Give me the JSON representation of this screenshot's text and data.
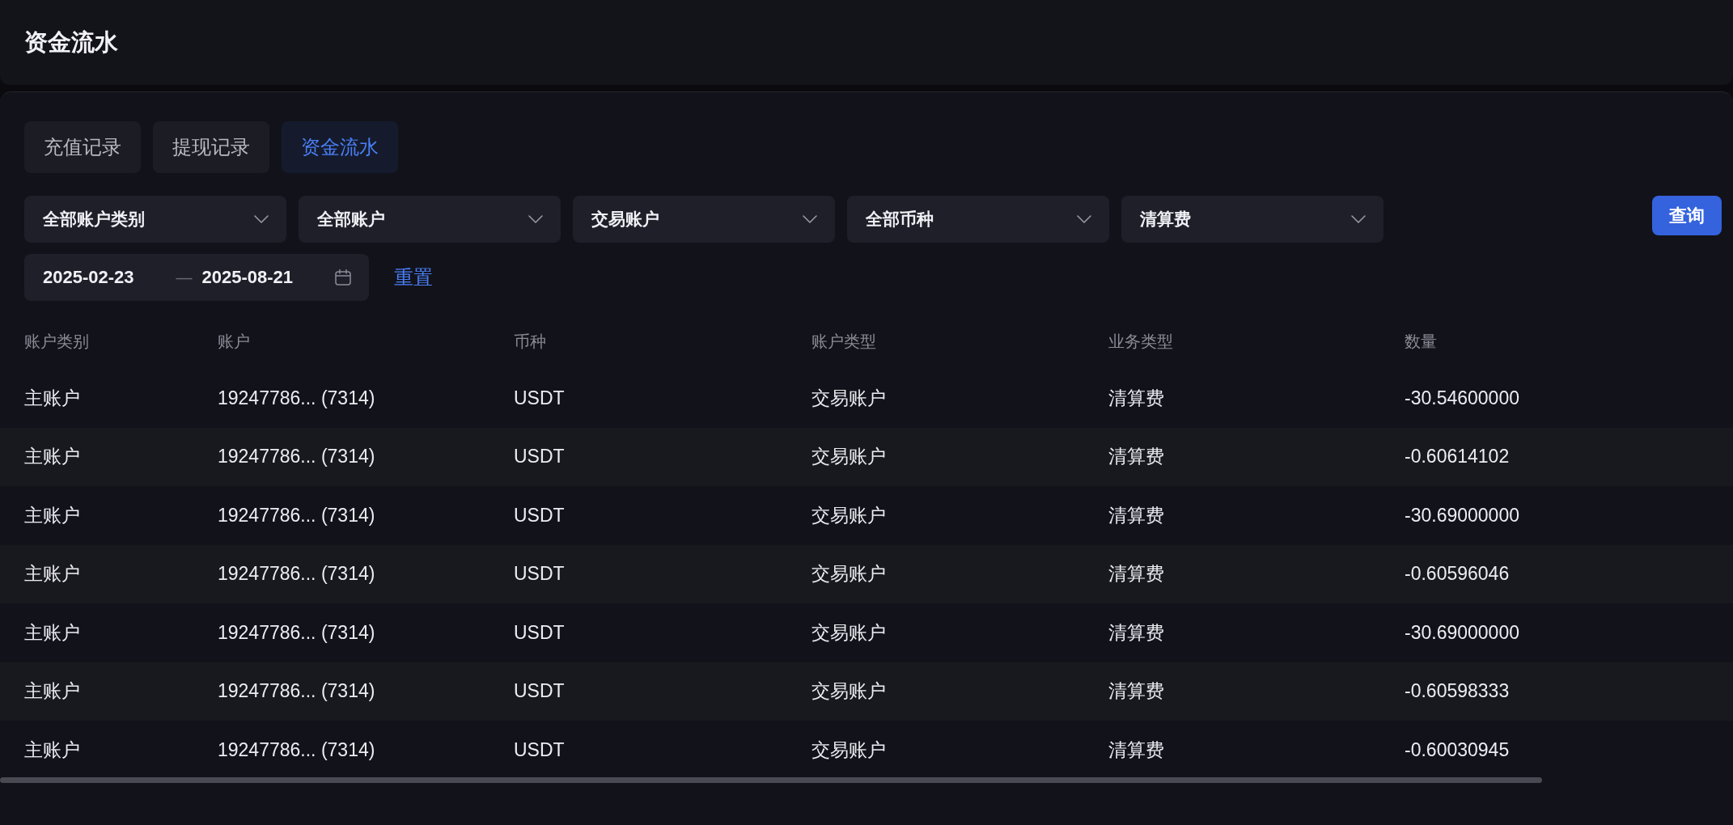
{
  "page": {
    "title": "资金流水"
  },
  "tabs": [
    {
      "label": "充值记录",
      "selected": false
    },
    {
      "label": "提现记录",
      "selected": false
    },
    {
      "label": "资金流水",
      "selected": true
    }
  ],
  "filters": [
    {
      "value": "全部账户类别"
    },
    {
      "value": "全部账户"
    },
    {
      "value": "交易账户"
    },
    {
      "value": "全部币种"
    },
    {
      "value": "清算费"
    }
  ],
  "query_button": {
    "label": "查询"
  },
  "date_range": {
    "start": "2025-02-23",
    "separator": "—",
    "end": "2025-08-21"
  },
  "reset_link": {
    "label": "重置"
  },
  "table": {
    "columns": [
      "账户类别",
      "账户",
      "币种",
      "账户类型",
      "业务类型",
      "数量"
    ],
    "rows": [
      [
        "主账户",
        "19247786... (7314)",
        "USDT",
        "交易账户",
        "清算费",
        "-30.54600000"
      ],
      [
        "主账户",
        "19247786... (7314)",
        "USDT",
        "交易账户",
        "清算费",
        "-0.60614102"
      ],
      [
        "主账户",
        "19247786... (7314)",
        "USDT",
        "交易账户",
        "清算费",
        "-30.69000000"
      ],
      [
        "主账户",
        "19247786... (7314)",
        "USDT",
        "交易账户",
        "清算费",
        "-0.60596046"
      ],
      [
        "主账户",
        "19247786... (7314)",
        "USDT",
        "交易账户",
        "清算费",
        "-30.69000000"
      ],
      [
        "主账户",
        "19247786... (7314)",
        "USDT",
        "交易账户",
        "清算费",
        "-0.60598333"
      ],
      [
        "主账户",
        "19247786... (7314)",
        "USDT",
        "交易账户",
        "清算费",
        "-0.60030945"
      ]
    ]
  }
}
